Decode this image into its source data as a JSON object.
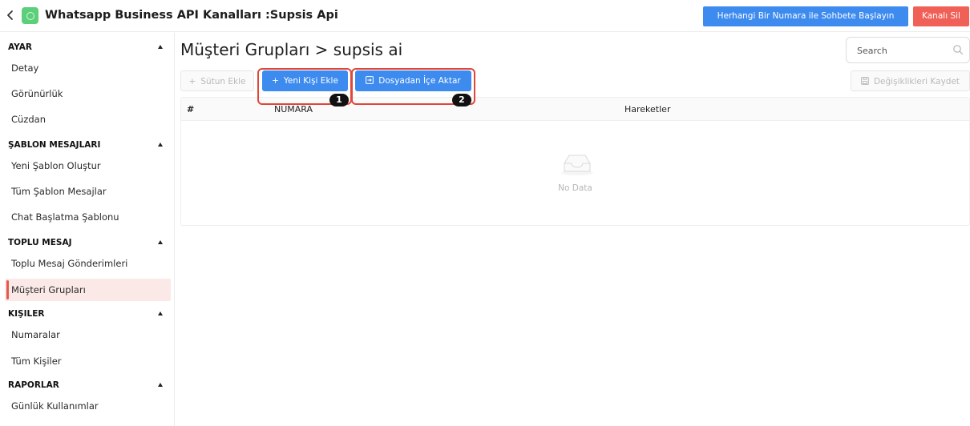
{
  "header": {
    "back_icon": "chevron-left-icon",
    "logo_icon": "whatsapp-icon",
    "title": "Whatsapp Business API Kanalları :Supsis Api",
    "start_chat_label": "Herhangi Bir Numara ile Sohbete Başlayın",
    "delete_channel_label": "Kanalı Sil",
    "colors": {
      "primary": "#3d8bef",
      "danger": "#f06057"
    }
  },
  "sidebar": {
    "sections": [
      {
        "title": "AYAR",
        "items": [
          "Detay",
          "Görünürlük",
          "Cüzdan"
        ]
      },
      {
        "title": "ŞABLON MESAJLARI",
        "items": [
          "Yeni Şablon Oluştur",
          "Tüm Şablon Mesajlar",
          "Chat Başlatma Şablonu"
        ]
      },
      {
        "title": "TOPLU MESAJ",
        "items": [
          "Toplu Mesaj Gönderimleri",
          "Müşteri Grupları"
        ]
      },
      {
        "title": "KIŞILER",
        "items": [
          "Numaralar",
          "Tüm Kişiler"
        ]
      },
      {
        "title": "RAPORLAR",
        "items": [
          "Günlük Kullanımlar"
        ]
      }
    ],
    "active_item": "Müşteri Grupları",
    "active_color": "#e25a4c"
  },
  "main": {
    "title": "Müşteri Grupları > supsis ai",
    "search": {
      "placeholder": "Search",
      "value": ""
    },
    "toolbar": {
      "add_column": "Sütun Ekle",
      "new_contact": "Yeni Kişi Ekle",
      "import_file": "Dosyadan İçe Aktar",
      "save_changes": "Değişiklikleri Kaydet"
    },
    "annotations": {
      "step1": "1",
      "step2": "2",
      "highlight_color": "#e0473a"
    },
    "table": {
      "columns": [
        "#",
        "NUMARA",
        "Hareketler"
      ],
      "empty_text": "No Data"
    }
  }
}
